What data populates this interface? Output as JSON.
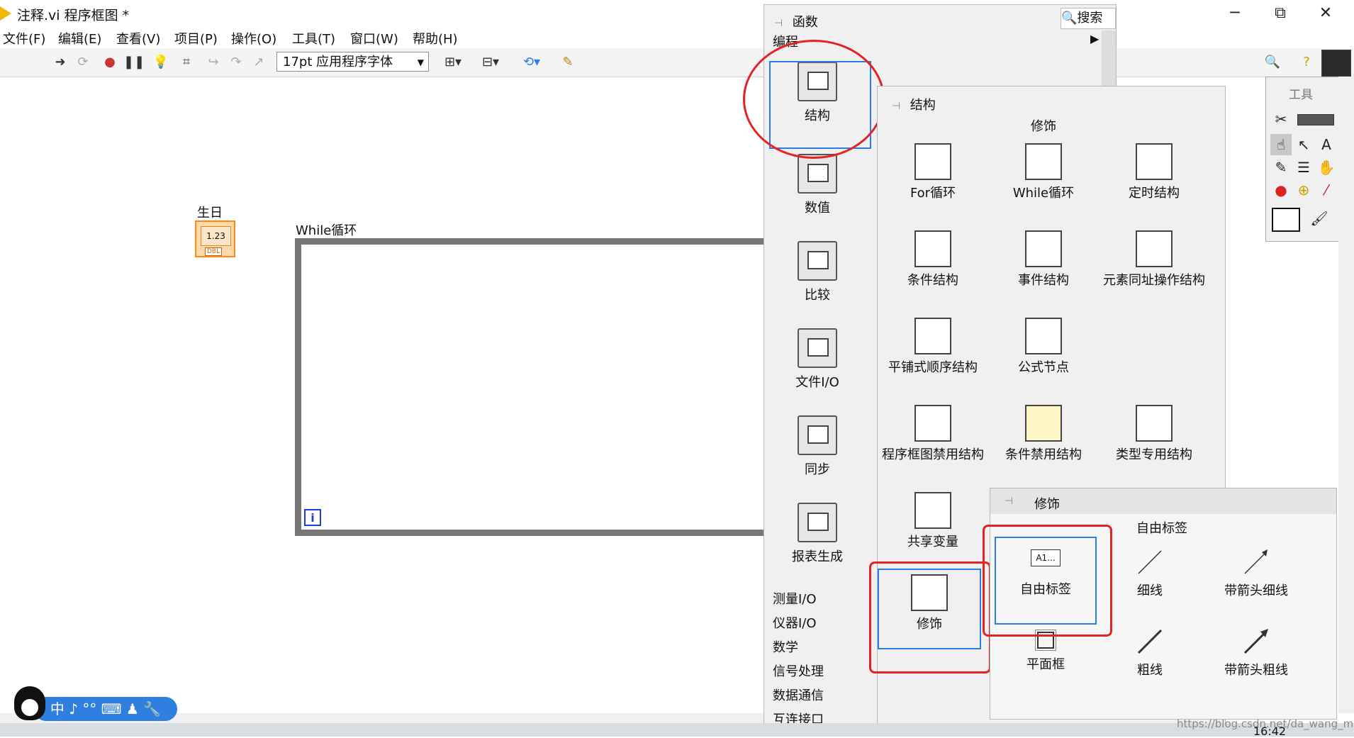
{
  "window": {
    "title": "注释.vi 程序框图 *",
    "controls": {
      "minimize": "─",
      "maximize": "⧉",
      "close": "✕"
    }
  },
  "menu": [
    "文件(F)",
    "编辑(E)",
    "查看(V)",
    "项目(P)",
    "操作(O)",
    "工具(T)",
    "窗口(W)",
    "帮助(H)"
  ],
  "toolbar": {
    "font": "17pt 应用程序字体"
  },
  "diagram": {
    "constant_label": "生日",
    "constant_value": "1.23",
    "constant_type": "DBL",
    "while_label": "While循环",
    "iteration": "i"
  },
  "functions_palette": {
    "title": "函数",
    "search": "搜索",
    "category": "编程",
    "categories": [
      "结构",
      "数值",
      "比较",
      "文件I/O",
      "同步",
      "报表生成"
    ],
    "list": [
      "测量I/O",
      "仪器I/O",
      "数学",
      "信号处理",
      "数据通信",
      "互连接口"
    ]
  },
  "structures_palette": {
    "title": "结构",
    "decor_header": "修饰",
    "items": [
      "For循环",
      "While循环",
      "定时结构",
      "条件结构",
      "事件结构",
      "元素同址操作结构",
      "平铺式顺序结构",
      "公式节点",
      "程序框图禁用结构",
      "条件禁用结构",
      "类型专用结构",
      "共享变量",
      "修饰"
    ]
  },
  "decorations_palette": {
    "title": "修饰",
    "tooltip": "自由标签",
    "items": [
      "自由标签",
      "细线",
      "带箭头细线",
      "平面框",
      "粗线",
      "带箭头粗线"
    ]
  },
  "tools_palette": {
    "title": "工具"
  },
  "taskbar": {
    "ime": "中 ♪ °° ⌨ ♟ 🔧",
    "clock": "16:42",
    "watermark": "https://blog.csdn.net/da_wang_mao"
  },
  "colors": {
    "highlight": "#e52222",
    "selection": "#2b7de9",
    "constant": "#ff8a18"
  }
}
